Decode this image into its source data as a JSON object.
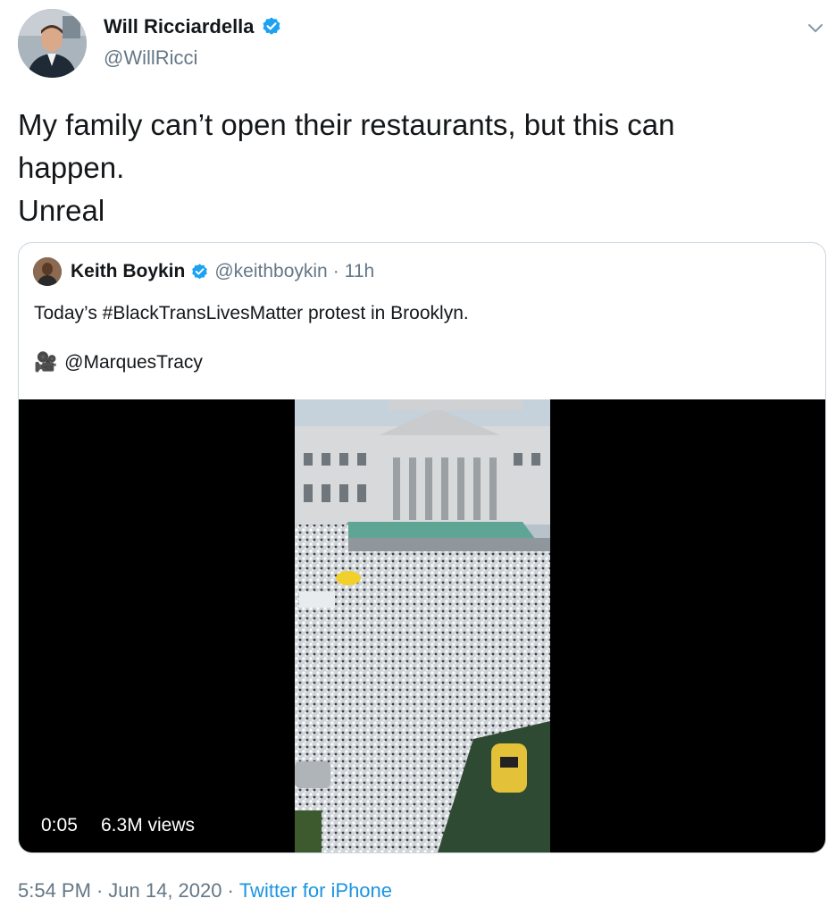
{
  "author": {
    "name": "Will Ricciardella",
    "handle": "@WillRicci",
    "verified": true
  },
  "tweet": {
    "text": "My family can’t open their restaurants, but this can\nhappen.\nUnreal"
  },
  "quoted": {
    "name": "Keith Boykin",
    "handle": "@keithboykin",
    "separator": "·",
    "age": "11h",
    "text": "Today’s #BlackTransLivesMatter protest in Brooklyn.",
    "credit_icon": "🎥",
    "credit": "@MarquesTracy",
    "video": {
      "duration": "0:05",
      "views": "6.3M views"
    }
  },
  "footer": {
    "time": "5:54 PM",
    "sep1": "·",
    "date": "Jun 14, 2020",
    "sep2": "·",
    "source": "Twitter for iPhone"
  },
  "icons": {
    "verified": "verified-badge-icon",
    "menu": "chevron-down-icon"
  },
  "colors": {
    "verified": "#1da1f2",
    "link": "#1b95e0",
    "muted": "#657786",
    "border": "#ccd6dd"
  }
}
